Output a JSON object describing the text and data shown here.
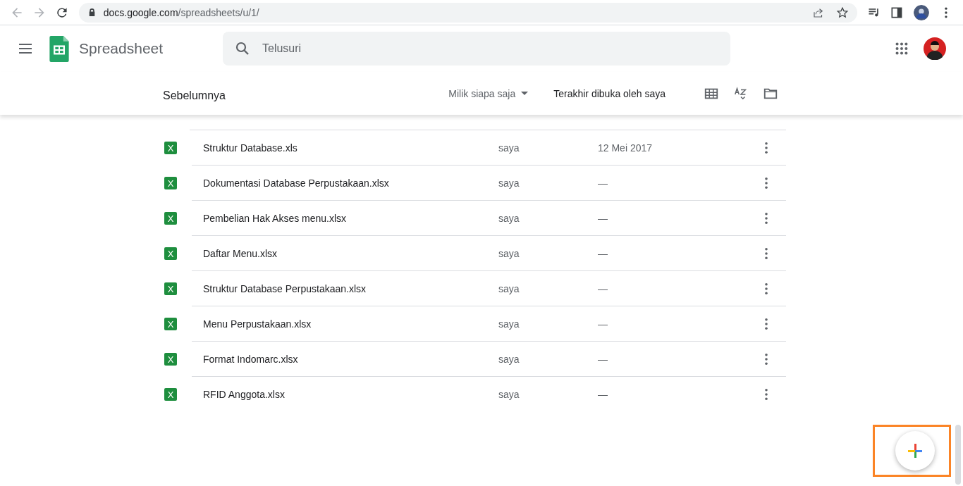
{
  "browser": {
    "url_host": "docs.google.com",
    "url_path": "/spreadsheets/u/1/"
  },
  "app": {
    "title": "Spreadsheet",
    "search": {
      "placeholder": "Telusuri"
    }
  },
  "toolbar": {
    "heading": "Sebelumnya",
    "owner_filter": "Milik siapa saja",
    "sort": "Terakhir dibuka oleh saya"
  },
  "files": [
    {
      "icon_letter": "X",
      "name": "Struktur Database.xls",
      "owner": "saya",
      "date": "12 Mei 2017"
    },
    {
      "icon_letter": "X",
      "name": "Dokumentasi Database Perpustakaan.xlsx",
      "owner": "saya",
      "date": "—"
    },
    {
      "icon_letter": "X",
      "name": "Pembelian Hak Akses menu.xlsx",
      "owner": "saya",
      "date": "—"
    },
    {
      "icon_letter": "X",
      "name": "Daftar Menu.xlsx",
      "owner": "saya",
      "date": "—"
    },
    {
      "icon_letter": "X",
      "name": "Struktur Database Perpustakaan.xlsx",
      "owner": "saya",
      "date": "—"
    },
    {
      "icon_letter": "X",
      "name": "Menu Perpustakaan.xlsx",
      "owner": "saya",
      "date": "—"
    },
    {
      "icon_letter": "X",
      "name": "Format Indomarc.xlsx",
      "owner": "saya",
      "date": "—"
    },
    {
      "icon_letter": "X",
      "name": "RFID Anggota.xlsx",
      "owner": "saya",
      "date": "—"
    }
  ]
}
